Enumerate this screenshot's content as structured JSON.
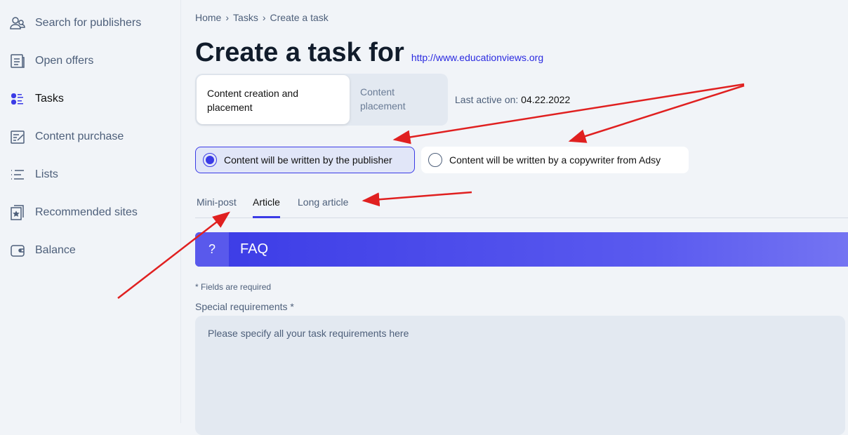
{
  "sidebar": {
    "items": [
      {
        "label": "Search for publishers",
        "icon": "users-icon"
      },
      {
        "label": "Open offers",
        "icon": "document-icon"
      },
      {
        "label": "Tasks",
        "icon": "tasks-icon",
        "active": true
      },
      {
        "label": "Content purchase",
        "icon": "edit-icon"
      },
      {
        "label": "Lists",
        "icon": "list-icon"
      },
      {
        "label": "Recommended sites",
        "icon": "star-bookmark-icon"
      },
      {
        "label": "Balance",
        "icon": "wallet-icon"
      }
    ]
  },
  "breadcrumb": [
    "Home",
    "Tasks",
    "Create a task"
  ],
  "page": {
    "title": "Create a task for",
    "site": "http://www.educationviews.org"
  },
  "segment": {
    "options": [
      "Content creation and placement",
      "Content placement"
    ],
    "selected": 0
  },
  "last_active": {
    "label": "Last active on:",
    "value": "04.22.2022"
  },
  "writer": {
    "options": [
      "Content will be written by the publisher",
      "Content will be written by a copywriter from Adsy"
    ],
    "selected": 0
  },
  "tabs": {
    "items": [
      "Mini-post",
      "Article",
      "Long article"
    ],
    "active": 1
  },
  "faq": {
    "icon": "?",
    "label": "FAQ"
  },
  "form": {
    "required_note": "* Fields are required",
    "special_label": "Special requirements *",
    "special_placeholder": "Please specify all your task requirements here"
  },
  "colors": {
    "accent": "#3b3be6",
    "annotation": "#e02020"
  }
}
